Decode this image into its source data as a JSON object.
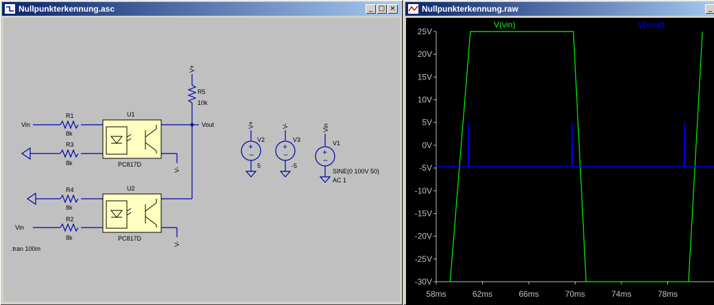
{
  "schematic_window": {
    "title": "Nullpunkterkennung.asc",
    "buttons": {
      "minimize": "_",
      "maximize": "□",
      "close": "×"
    },
    "labels": {
      "vplus_top": "V+",
      "r5": "R5",
      "r5_val": "10k",
      "vout": "Vout",
      "r1": "R1",
      "r1_val": "8k",
      "u1": "U1",
      "vin1": "Vin",
      "r3": "R3",
      "r3_val": "8k",
      "pc817_1": "PC817D",
      "vminus_u1": "V-",
      "r4": "R4",
      "r4_val": "8k",
      "u2": "U2",
      "r2": "R2",
      "r2_val": "8k",
      "vin2": "Vin",
      "pc817_2": "PC817D",
      "vminus_u2": "V-",
      "tran": ".tran 100m",
      "v2_net": "V+",
      "v2": "V2",
      "v2_val": "5",
      "v3_net": "V-",
      "v3": "V3",
      "v3_val": "-5",
      "v1_net": "Vin",
      "v1": "V1",
      "v1_val1": "SINE(0 100V 50)",
      "v1_val2": "AC 1"
    }
  },
  "waveform_window": {
    "title": "Nullpunkterkennung.raw",
    "buttons": {
      "minimize": "_"
    },
    "legend": {
      "vin": "V(vin)",
      "vout": "V(vout)"
    },
    "colors": {
      "vin": "#00ff00",
      "vout": "#0000ff",
      "background": "#000000"
    },
    "y_ticks": [
      "25V",
      "20V",
      "15V",
      "10V",
      "5V",
      "0V",
      "-5V",
      "-10V",
      "-15V",
      "-20V",
      "-25V",
      "-30V"
    ],
    "x_ticks": [
      "58ms",
      "62ms",
      "66ms",
      "70ms",
      "74ms",
      "78ms"
    ]
  },
  "chart_data": {
    "type": "line",
    "xlabel": "",
    "ylabel": "",
    "xlim": [
      58,
      82
    ],
    "ylim": [
      -30,
      25
    ],
    "grid": false,
    "legend": "top",
    "series": [
      {
        "name": "V(vin)",
        "color": "#00ff00",
        "x": [
          59.2,
          60.95,
          69.85,
          70.95,
          79.8,
          81.0
        ],
        "y": [
          -30,
          25,
          25,
          -30,
          -30,
          25
        ]
      },
      {
        "name": "V(vout)",
        "color": "#0000ff",
        "x": [
          58.0,
          60.75,
          60.8,
          60.85,
          61.0,
          69.7,
          69.75,
          69.8,
          69.95,
          79.4,
          79.45,
          79.5,
          82.0
        ],
        "y": [
          -4.7,
          -4.7,
          5.0,
          -4.7,
          -4.7,
          -4.7,
          5.0,
          -4.7,
          -4.7,
          -4.7,
          5.0,
          -4.7,
          -4.7
        ]
      }
    ]
  }
}
